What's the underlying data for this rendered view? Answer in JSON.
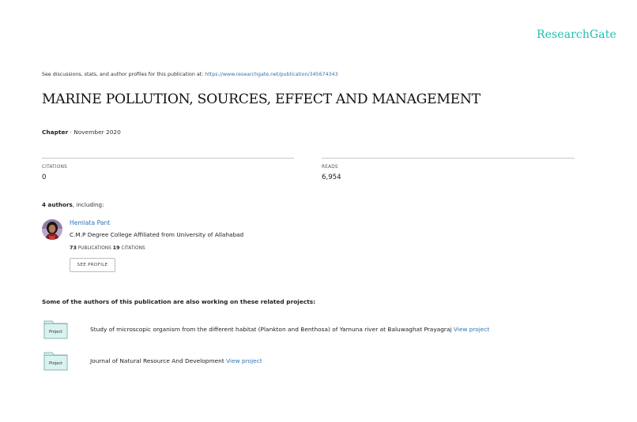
{
  "brand": {
    "name": "ResearchGate"
  },
  "discussion": {
    "text": "See discussions, stats, and author profiles for this publication at: ",
    "link": "https://www.researchgate.net/publication/345674343"
  },
  "publication": {
    "title": "MARINE POLLUTION, SOURCES, EFFECT AND MANAGEMENT",
    "type": "Chapter",
    "separator": " · ",
    "date": "November 2020"
  },
  "stats": {
    "citations_label": "CITATIONS",
    "citations_value": "0",
    "reads_label": "READS",
    "reads_value": "6,954"
  },
  "authors": {
    "count_bold": "4 authors",
    "count_suffix": ", including:",
    "list": [
      {
        "name": "Hemlata Pant",
        "affiliation": "C.M.P Degree College Affiliated from University of Allahabad",
        "publications_count": "73",
        "publications_label": "PUBLICATIONS",
        "citations_count": "19",
        "citations_label": "CITATIONS",
        "profile_button": "SEE PROFILE"
      }
    ]
  },
  "projects": {
    "heading": "Some of the authors of this publication are also working on these related projects:",
    "items": [
      {
        "icon_label": "Project",
        "text": "Study of microscopic organism from the different habitat (Plankton and Benthosa) of Yamuna river at Baluwaghat Prayagraj ",
        "link": "View project"
      },
      {
        "icon_label": "Project",
        "text": "Journal of Natural Resource And Development ",
        "link": "View project"
      }
    ]
  },
  "colors": {
    "brand": "#1fbfae",
    "link": "#2f73b3",
    "folder_fill": "#cdeeea",
    "folder_stroke": "#7fa8a3"
  }
}
